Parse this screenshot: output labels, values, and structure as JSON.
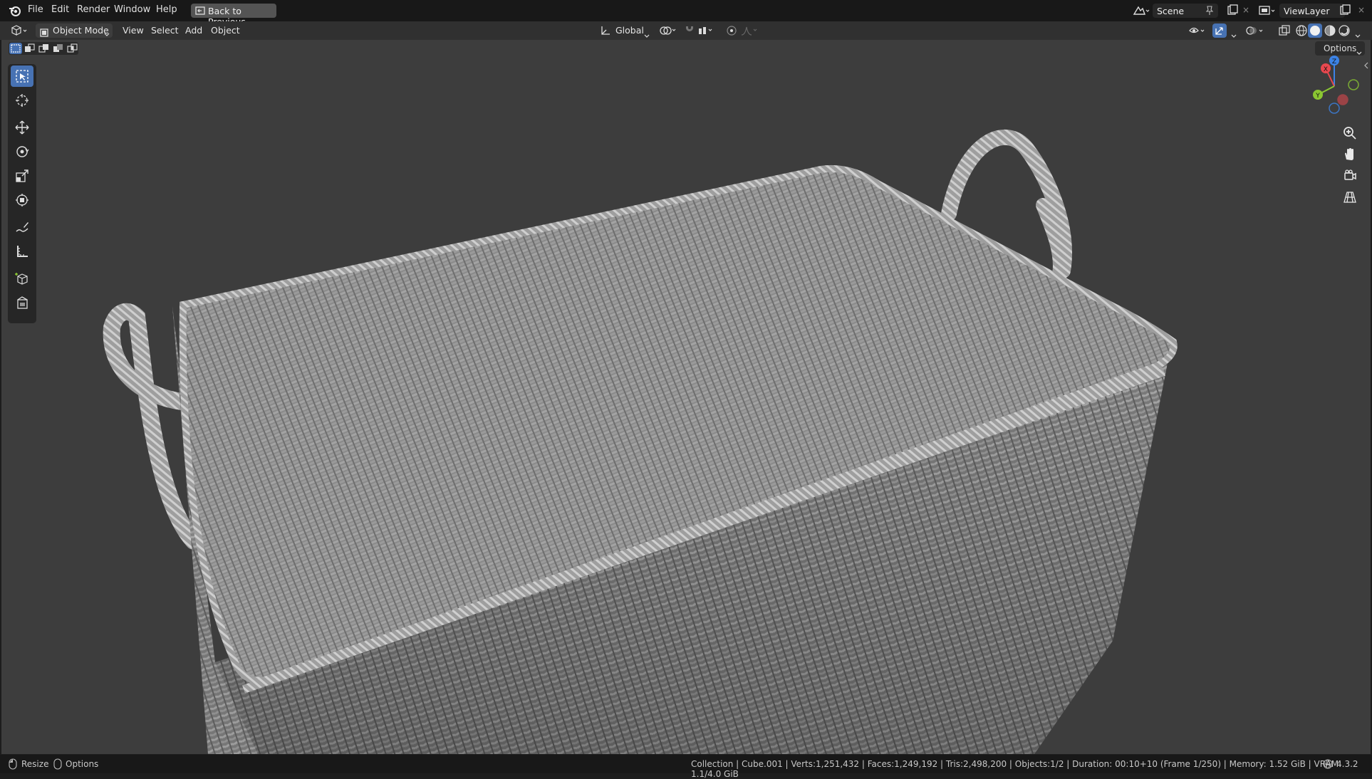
{
  "menu": {
    "file": "File",
    "edit": "Edit",
    "render": "Render",
    "window": "Window",
    "help": "Help",
    "back_to_previous": "Back to Previous"
  },
  "scene": {
    "name": "Scene"
  },
  "view_layer": {
    "name": "ViewLayer"
  },
  "header": {
    "mode": "Object Mode",
    "view": "View",
    "select": "Select",
    "add": "Add",
    "object": "Object",
    "orientation": "Global",
    "options": "Options"
  },
  "gizmo": {
    "x": "X",
    "y": "Y",
    "z": "Z"
  },
  "status": {
    "resize": "Resize",
    "options": "Options",
    "stats": "Collection | Cube.001 | Verts:1,251,432 | Faces:1,249,192 | Tris:2,498,200 | Objects:1/2 | Duration: 00:10+10 (Frame 1/250) | Memory: 1.52 GiB | VRAM: 1.1/4.0 GiB",
    "version": "4.3.2"
  },
  "colors": {
    "accent": "#4772b3",
    "viewport_bg": "#3d3d3d",
    "axis_x": "#e8484f",
    "axis_y": "#8bc732",
    "axis_z": "#3c83e6"
  }
}
